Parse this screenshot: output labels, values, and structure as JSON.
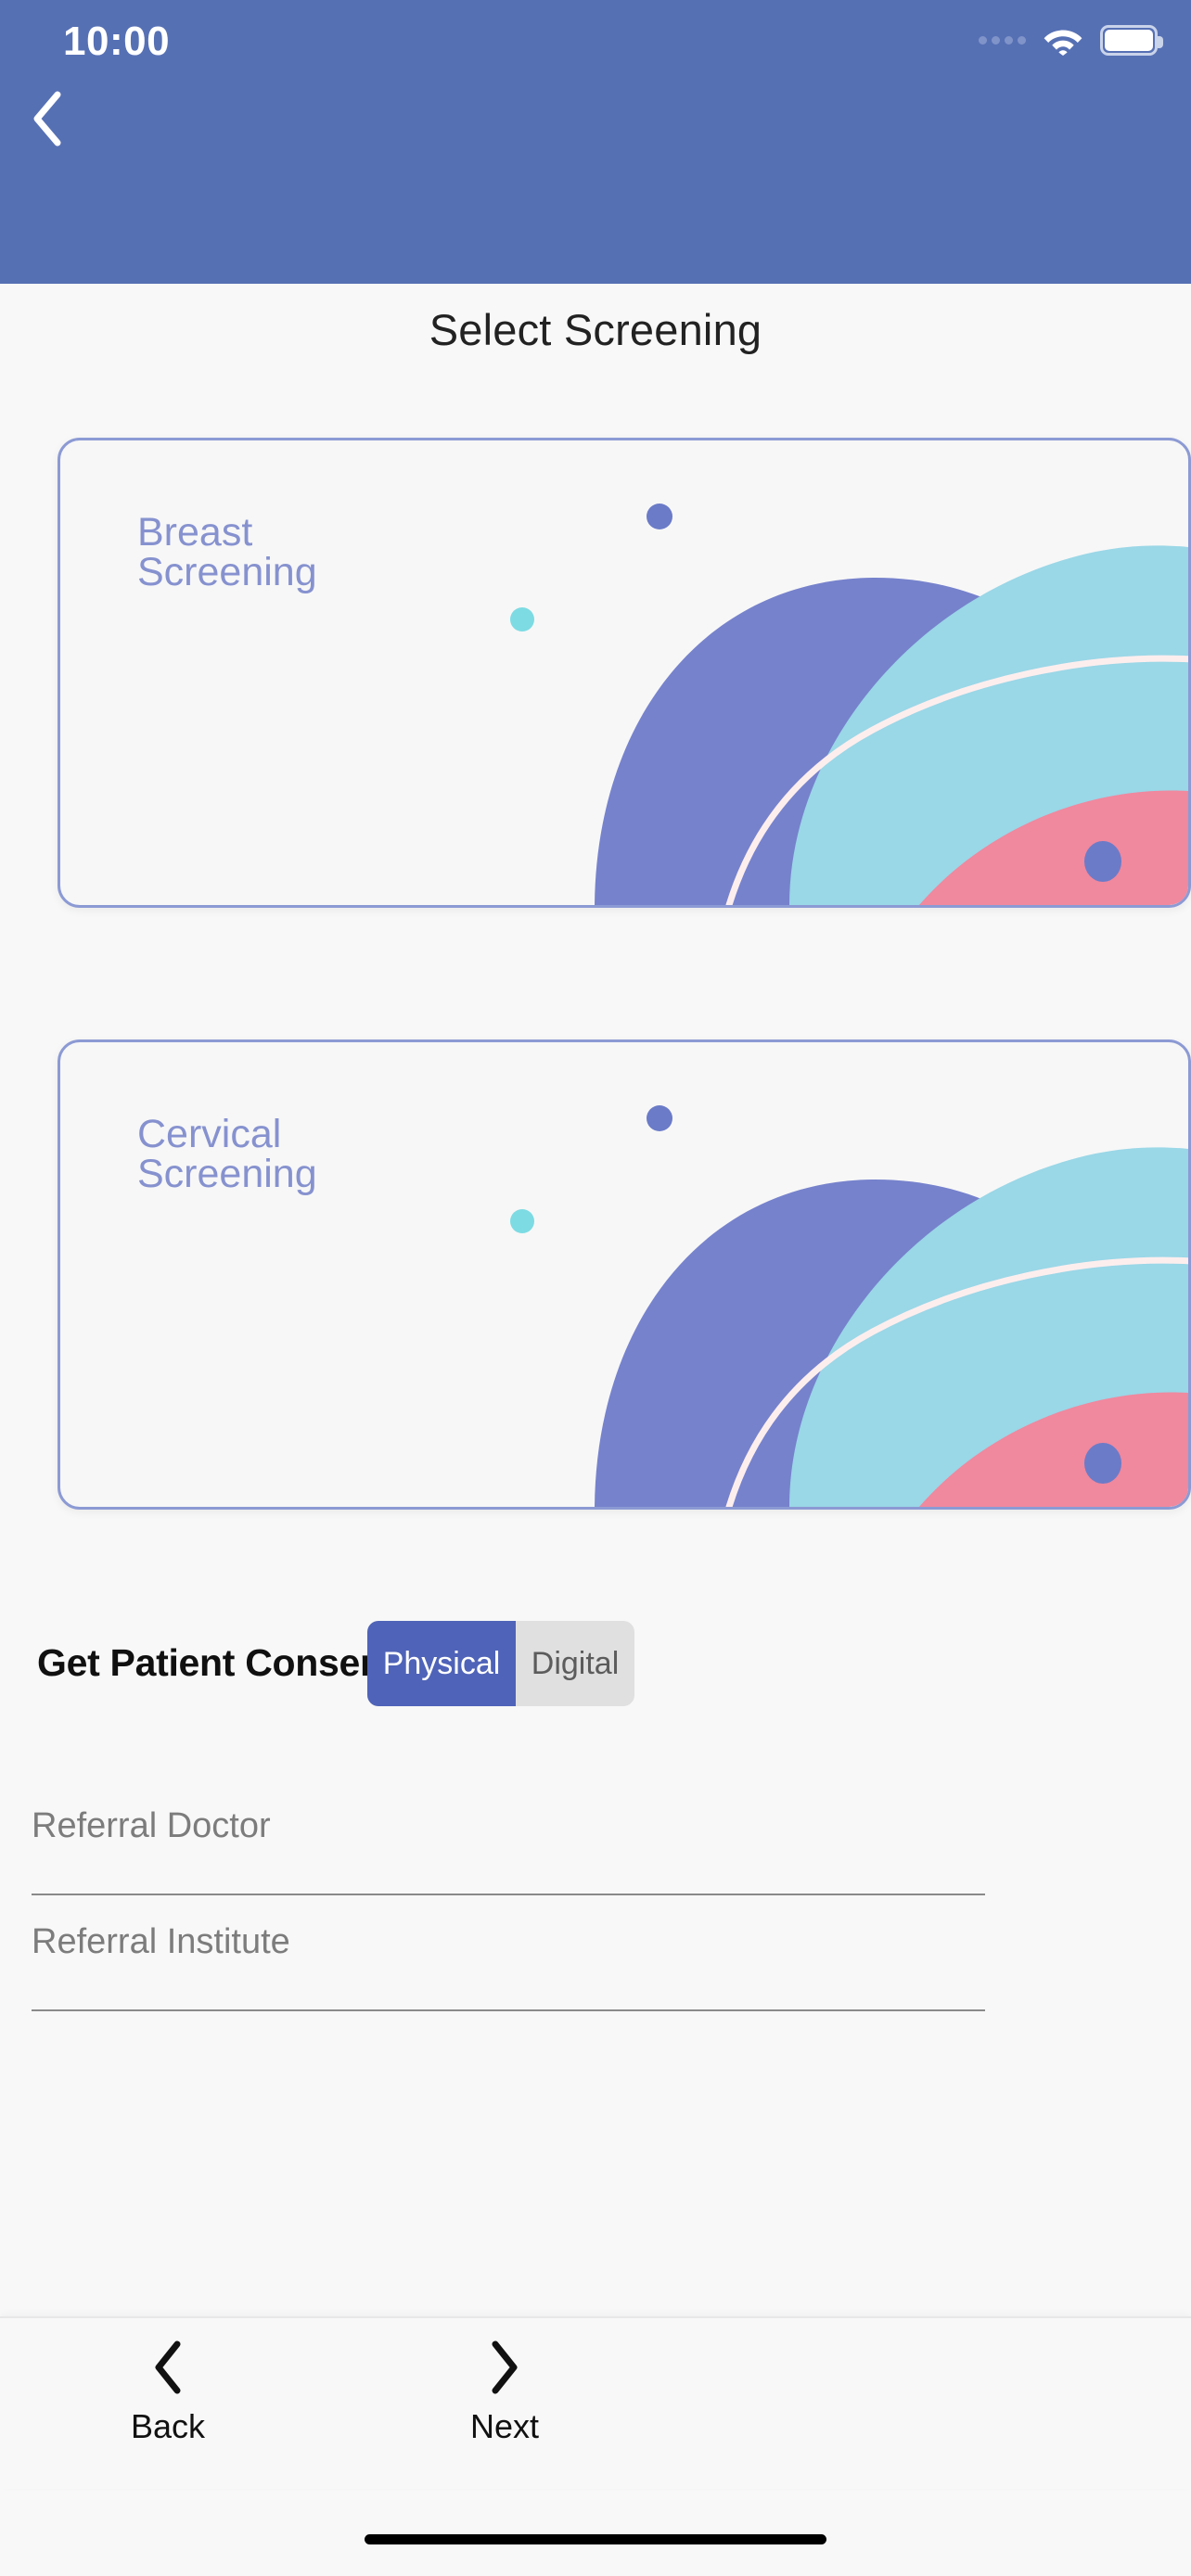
{
  "status_bar": {
    "time": "10:00",
    "signal_icon": "signal-dots-icon",
    "wifi_icon": "wifi-icon",
    "battery_icon": "battery-full-icon"
  },
  "header": {
    "back_icon": "chevron-left-icon",
    "accent_color": "#5670b4"
  },
  "page": {
    "title": "Select Screening",
    "background_color": "#f8f8f8"
  },
  "screening_cards": [
    {
      "label": "Breast\nScreening",
      "text_color": "#8692cf",
      "border_color": "#8c9ad4"
    },
    {
      "label": "Cervical\nScreening",
      "text_color": "#8692cf",
      "border_color": "#8c9ad4"
    }
  ],
  "illustration_colors": {
    "purple_blob": "#7682cc",
    "cyan_blob": "#9ad7e7",
    "pink_blob": "#f0889e",
    "stroke": "#fdeeee",
    "dot_purple": "#6b7bc8",
    "dot_cyan": "#7ddbe3"
  },
  "consent": {
    "label": "Get Patient Consent:",
    "options": [
      "Physical",
      "Digital"
    ],
    "selected": "Physical",
    "active_color": "#4f63b8",
    "inactive_color": "#e0e0e0"
  },
  "fields": [
    {
      "placeholder": "Referral Doctor",
      "value": ""
    },
    {
      "placeholder": "Referral Institute",
      "value": ""
    }
  ],
  "bottom_nav": {
    "back": {
      "label": "Back",
      "icon": "chevron-left-icon"
    },
    "next": {
      "label": "Next",
      "icon": "chevron-right-icon"
    }
  }
}
